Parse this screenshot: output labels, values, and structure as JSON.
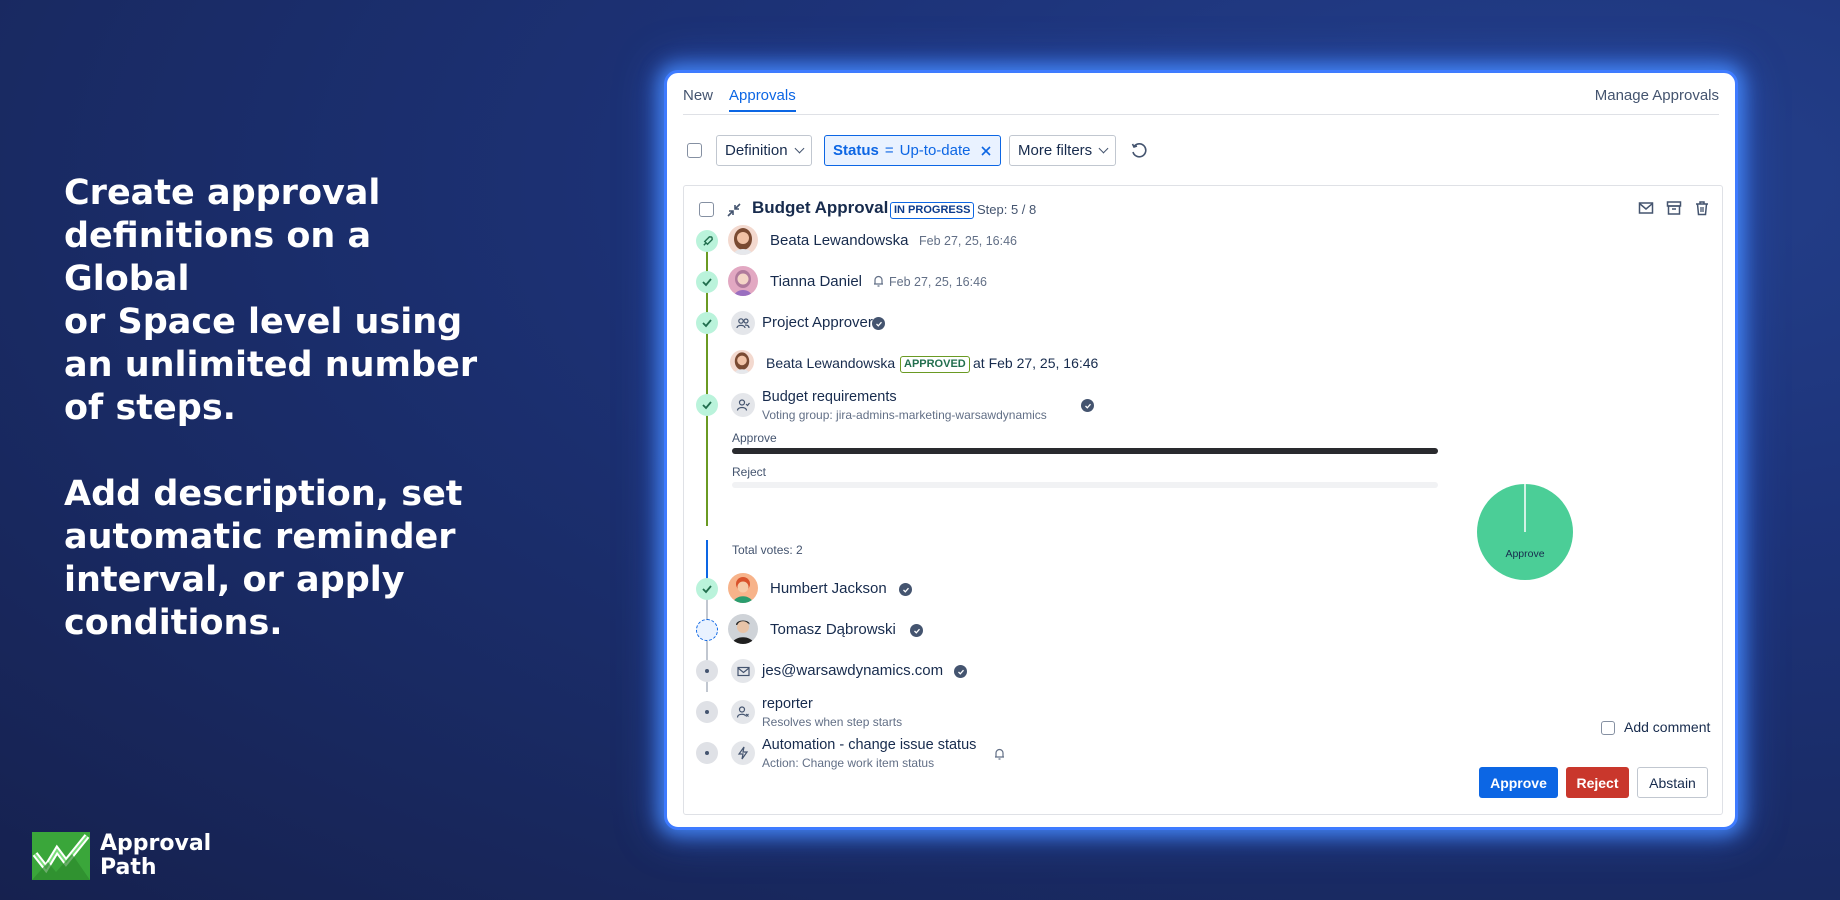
{
  "hero": {
    "line1": "Create approval\ndefinitions on a Global\nor Space level using\nan unlimited number\nof steps.",
    "line2": "Add description, set\nautomatic reminder\ninterval, or apply\nconditions."
  },
  "brand": {
    "name": "Approval\nPath",
    "colors": {
      "green": "#4bbf4b",
      "white": "#ffffff"
    }
  },
  "tabs": {
    "new": "New",
    "approvals": "Approvals",
    "manage": "Manage Approvals"
  },
  "filters": {
    "definition": "Definition",
    "status_key": "Status",
    "status_op": "=",
    "status_value": "Up-to-date",
    "more": "More filters"
  },
  "approval": {
    "title": "Budget Approval",
    "status": "IN PROGRESS",
    "step": "Step: 5 / 8",
    "steps": [
      {
        "name": "Beata Lewandowska",
        "time": "Feb 27, 25, 16:46",
        "icon": "rocket-icon"
      },
      {
        "name": "Tianna Daniel",
        "time": "Feb 27, 25, 16:46",
        "icon": "bell-icon"
      },
      {
        "name": "Project Approvers"
      },
      {
        "name": "Beata Lewandowska",
        "badge": "APPROVED",
        "time": "at Feb 27, 25, 16:46"
      },
      {
        "name": "Budget requirements",
        "sub": "Voting group: jira-admins-marketing-warsawdynamics"
      },
      {
        "name": "Humbert Jackson"
      },
      {
        "name": "Tomasz Dąbrowski"
      },
      {
        "name": "jes@warsawdynamics.com"
      },
      {
        "name": "reporter",
        "sub": "Resolves when step starts"
      },
      {
        "name": "Automation - change issue status",
        "sub": "Action: Change work item status"
      }
    ],
    "votes": {
      "approve_label": "Approve",
      "reject_label": "Reject",
      "total": "Total votes: 2",
      "approve_fraction": 1.0,
      "reject_fraction": 0.0
    }
  },
  "chart_data": {
    "type": "pie",
    "categories": [
      "Approve",
      "Reject"
    ],
    "values": [
      2,
      0
    ],
    "labels": [
      "Approve"
    ],
    "colors": [
      "#4bce97",
      "#ffffff"
    ]
  },
  "actions": {
    "add_comment": "Add comment",
    "approve": "Approve",
    "reject": "Reject",
    "abstain": "Abstain"
  },
  "colors": {
    "primary": "#0c66e4",
    "danger": "#c9372c",
    "success_bg": "#baf3db",
    "pie": "#4bce97"
  }
}
